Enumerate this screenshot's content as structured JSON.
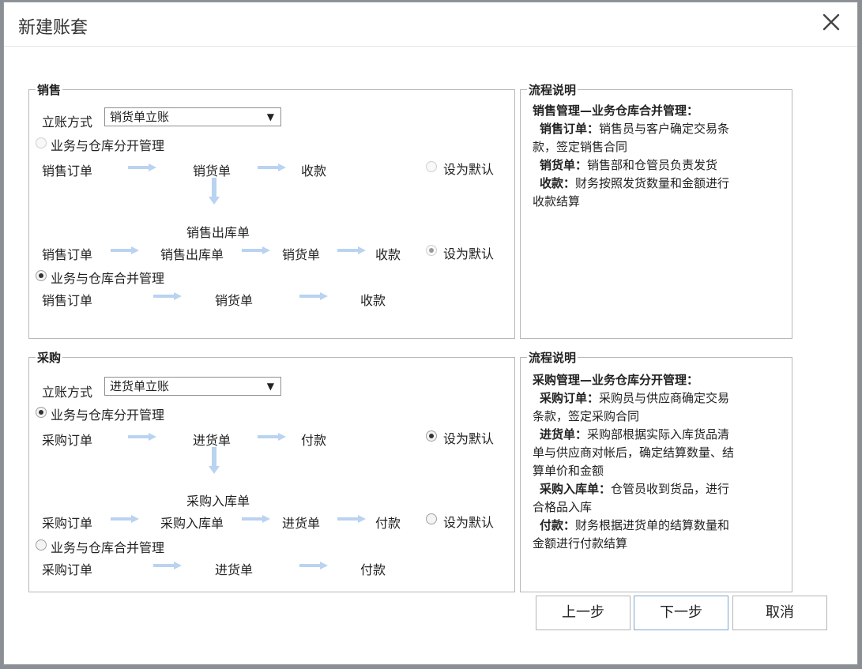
{
  "dialog": {
    "title": "新建账套",
    "close_symbol": "✕"
  },
  "sales": {
    "legend": "销售",
    "method_label": "立账方式",
    "method_value": "销货单立账",
    "option_separate": "业务与仓库分开管理",
    "option_merged": "业务与仓库合并管理",
    "flow1": [
      "销售订单",
      "销货单",
      "收款"
    ],
    "out_label": "销售出库单",
    "flow2": [
      "销售订单",
      "销售出库单",
      "销货单",
      "收款"
    ],
    "flow3": [
      "销售订单",
      "销货单",
      "收款"
    ],
    "set_default": "设为默认"
  },
  "sales_note": {
    "legend": "流程说明",
    "heading": "销售管理—业务仓库合并管理：",
    "items": [
      {
        "term": "销售订单：",
        "desc": "销售员与客户确定交易条"
      },
      {
        "term": "",
        "desc": "款，签定销售合同"
      },
      {
        "term": "销货单：",
        "desc": "销售部和仓管员负责发货"
      },
      {
        "term": "收款：",
        "desc": "财务按照发货数量和金额进行"
      },
      {
        "term": "",
        "desc": "收款结算"
      }
    ]
  },
  "purchase": {
    "legend": "采购",
    "method_label": "立账方式",
    "method_value": "进货单立账",
    "option_separate": "业务与仓库分开管理",
    "option_merged": "业务与仓库合并管理",
    "flow1": [
      "采购订单",
      "进货单",
      "付款"
    ],
    "in_label": "采购入库单",
    "flow2": [
      "采购订单",
      "采购入库单",
      "进货单",
      "付款"
    ],
    "flow3": [
      "采购订单",
      "进货单",
      "付款"
    ],
    "set_default": "设为默认"
  },
  "purchase_note": {
    "legend": "流程说明",
    "heading": "采购管理—业务仓库分开管理：",
    "lines": [
      {
        "term": "采购订单：",
        "desc": "采购员与供应商确定交易"
      },
      {
        "term": "",
        "desc": "条款，签定采购合同"
      },
      {
        "term": "进货单：",
        "desc": "采购部根据实际入库货品清"
      },
      {
        "term": "",
        "desc": "单与供应商对帐后，确定结算数量、结"
      },
      {
        "term": "",
        "desc": "算单价和金额"
      },
      {
        "term": "采购入库单：",
        "desc": "仓管员收到货品，进行"
      },
      {
        "term": "",
        "desc": "合格品入库"
      },
      {
        "term": "付款：",
        "desc": "财务根据进货单的结算数量和"
      },
      {
        "term": "",
        "desc": "金额进行付款结算"
      }
    ]
  },
  "buttons": {
    "prev": "上一步",
    "next": "下一步",
    "cancel": "取消"
  },
  "colors": {
    "flow_arrow": "#b9d3f0"
  }
}
